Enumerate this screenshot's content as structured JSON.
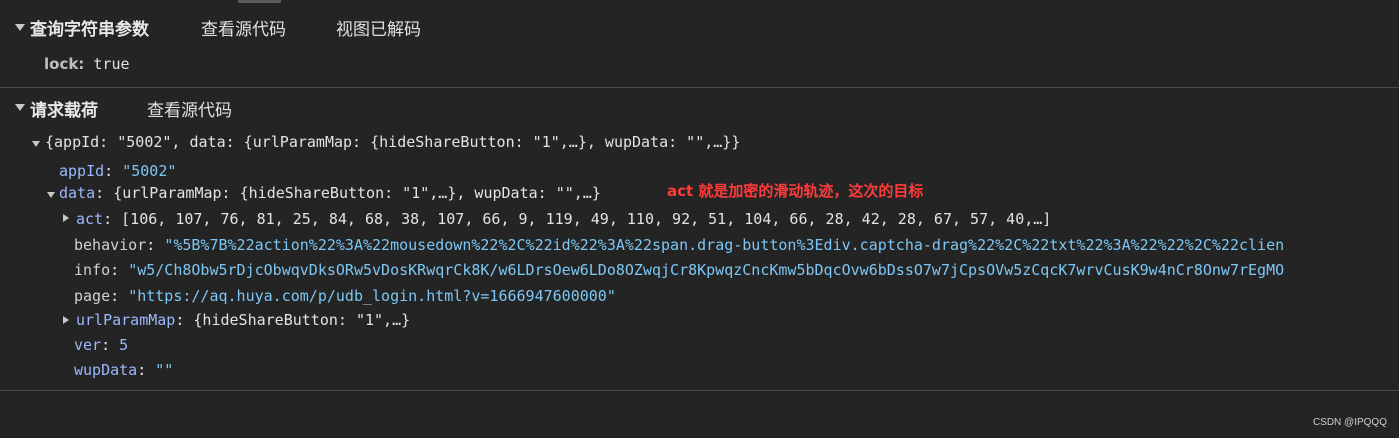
{
  "query": {
    "title": "查询字符串参数",
    "view_source": "查看源代码",
    "view_decoded": "视图已解码",
    "param_key": "lock:",
    "param_value": "true"
  },
  "payload": {
    "title": "请求载荷",
    "view_source": "查看源代码",
    "root_summary": "{appId: \"5002\", data: {urlParamMap: {hideShareButton: \"1\",…}, wupData: \"\",…}}",
    "appId_key": "appId",
    "appId_value": "\"5002\"",
    "data_key": "data",
    "data_summary": "{urlParamMap: {hideShareButton: \"1\",…}, wupData: \"\",…}",
    "annotation": "act 就是加密的滑动轨迹，这次的目标",
    "act_key": "act",
    "act_value": "[106, 107, 76, 81, 25, 84, 68, 38, 107, 66, 9, 119, 49, 110, 92, 51, 104, 66, 28, 42, 28, 67, 57, 40,…]",
    "behavior_key": "behavior",
    "behavior_value": "\"%5B%7B%22action%22%3A%22mousedown%22%2C%22id%22%3A%22span.drag-button%3Ediv.captcha-drag%22%2C%22txt%22%3A%22%22%2C%22clien",
    "info_key": "info",
    "info_value": "\"w5/Ch8Obw5rDjcObwqvDksORw5vDosKRwqrCk8K/w6LDrsOew6LDo8OZwqjCr8KpwqzCncKmw5bDqcOvw6bDssO7w7jCpsOVw5zCqcK7wrvCusK9w4nCr8Onw7rEgMO",
    "page_key": "page",
    "page_value": "\"https://aq.huya.com/p/udb_login.html?v=1666947600000\"",
    "urlParamMap_key": "urlParamMap",
    "urlParamMap_value": "{hideShareButton: \"1\",…}",
    "ver_key": "ver",
    "ver_value": "5",
    "wupData_key": "wupData",
    "wupData_value": "\"\""
  },
  "watermark": "CSDN @IPQQQ"
}
